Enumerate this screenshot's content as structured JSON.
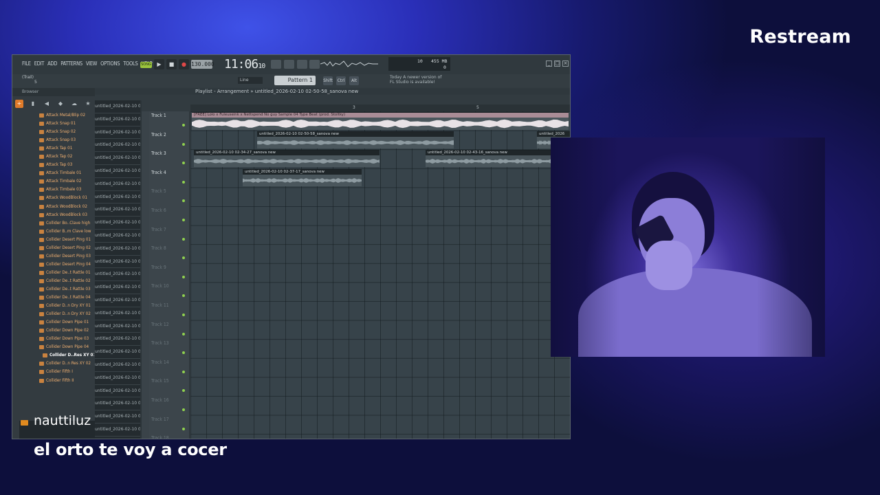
{
  "brand": "Restream",
  "fl_studio": {
    "menu": [
      "FILE",
      "EDIT",
      "ADD",
      "PATTERNS",
      "VIEW",
      "OPTIONS",
      "TOOLS",
      "HELP"
    ],
    "song_mode": "SONG",
    "tempo": "130.000",
    "time_main": "11:06",
    "time_sub": "10",
    "cpu_value": "10",
    "memory": "455 MB",
    "voices": "0",
    "trail": "(Trail)",
    "trail_sub": "5",
    "line_mode": "Line",
    "pattern": "Pattern 1",
    "snap_buttons": [
      "Shift",
      "Ctrl",
      "Alt"
    ],
    "hint_line1": "Today  A newer version of",
    "hint_line2": "FL Studio is available!",
    "playlist_title": "Playlist - Arrangement » untitled_2026-02-10 02-50-58_sanova new",
    "browser_label": "Browser",
    "browser_items": [
      "Attack Metal/Blip 02",
      "Attack Snap 01",
      "Attack Snap 02",
      "Attack Snap 03",
      "Attack Tap 01",
      "Attack Tap 02",
      "Attack Tap 03",
      "Attack Timbale 01",
      "Attack Timbale 02",
      "Attack Timbale 03",
      "Attack WoodBlock 01",
      "Attack WoodBlock 02",
      "Attack WoodBlock 03",
      "Collider Bo..Clave high",
      "Collider B..m Clave low",
      "Collider Desert Ping 01",
      "Collider Desert Ping 02",
      "Collider Desert Ping 03",
      "Collider Desert Ping 04",
      "Collider De..t Rattle 01",
      "Collider De..t Rattle 02",
      "Collider De..t Rattle 03",
      "Collider De..t Rattle 04",
      "Collider D..n Dry XY 01",
      "Collider D..n Dry XY 02",
      "Collider Down Pipe 01",
      "Collider Down Pipe 02",
      "Collider Down Pipe 03",
      "Collider Down Pipe 04",
      "Collider D..Res XY 01",
      "Collider D..n Res XY 02",
      "Collider Fifth I",
      "Collider Fifth II"
    ],
    "browser_selected_index": 29,
    "clip_list": [
      "untitled_2026-02-10 02-",
      "untitled_2026-02-10 02-",
      "untitled_2026-02-10 02-",
      "untitled_2026-02-10 02-",
      "untitled_2026-02-10 02-",
      "untitled_2026-02-10 02-",
      "untitled_2026-02-10 02-",
      "untitled_2026-02-10 02-",
      "untitled_2026-02-10 02-",
      "untitled_2026-02-10 02-",
      "untitled_2026-02-10 02-",
      "untitled_2026-02-10 02-",
      "untitled_2026-02-10 02-",
      "untitled_2026-02-10 02-",
      "untitled_2026-02-10 02-",
      "untitled_2026-02-10 02-",
      "untitled_2026-02-10 02-",
      "untitled_2026-02-10 02-",
      "untitled_2026-02-10 02-",
      "untitled_2026-02-10 02-",
      "untitled_2026-02-10 02-",
      "untitled_2026-02-10 02-",
      "untitled_2026-02-10 02-",
      "untitled_2026-02-10 02-",
      "untitled_2026-02-10 02-",
      "untitled_2026-02-10 02-",
      "untitled_2026-02-10 02-"
    ],
    "tracks": [
      "Track 1",
      "Track 2",
      "Track 3",
      "Track 4",
      "Track 5",
      "Track 6",
      "Track 7",
      "Track 8",
      "Track 9",
      "Track 10",
      "Track 11",
      "Track 12",
      "Track 13",
      "Track 14",
      "Track 15",
      "Track 16",
      "Track 17",
      "Track 18"
    ],
    "ruler_marks": [
      "3",
      "5"
    ],
    "clips": [
      {
        "track": 1,
        "label": "[FREE] Lolo x Fuleuseink x Nettspend No guy  Sample 04 Type Beat (prod. Stoltky)",
        "style": "light"
      },
      {
        "track": 2,
        "label": "untitled_2026-02-10 02-50-58_sanova new",
        "style": "dark"
      },
      {
        "track": 2,
        "label": "untitled_2026",
        "style": "dark"
      },
      {
        "track": 3,
        "label": "untitled_2026-02-10 02-34-27_sanova new",
        "style": "dark"
      },
      {
        "track": 3,
        "label": "untitled_2026-02-10 02-43-16_sanova new",
        "style": "dark"
      },
      {
        "track": 4,
        "label": "untitled_2026-02-10 02-37-17_sanova new",
        "style": "dark"
      }
    ]
  },
  "chat": {
    "username": "nauttiluz",
    "message": "el orto te voy a cocer"
  },
  "colors": {
    "accent": "#9bc53d",
    "browser_text": "#f0b071",
    "clip_light": "#a98c96"
  }
}
